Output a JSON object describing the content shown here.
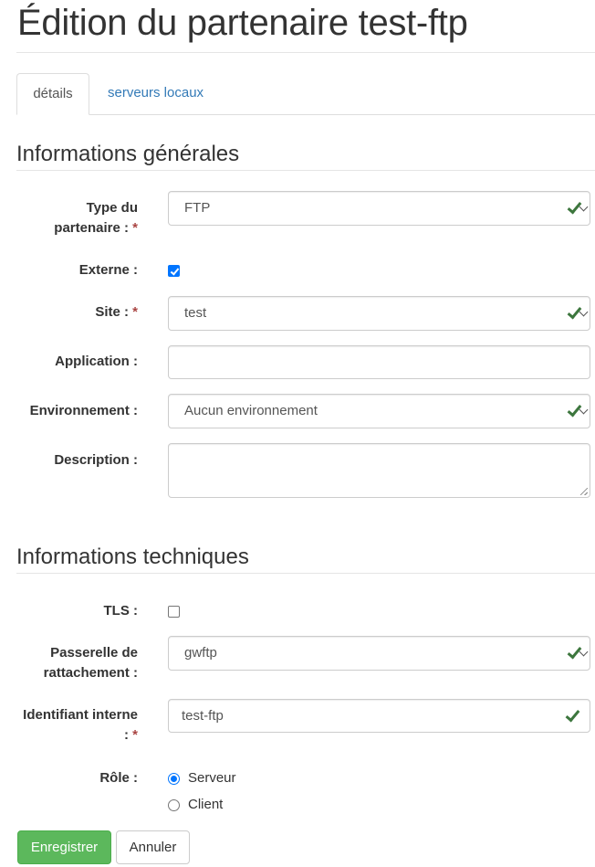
{
  "page": {
    "title": "Édition du partenaire test-ftp"
  },
  "tabs": [
    {
      "label": "détails",
      "active": true
    },
    {
      "label": "serveurs locaux",
      "active": false
    }
  ],
  "general": {
    "heading": "Informations générales",
    "type": {
      "label_line1": "Type du",
      "label_line2": "partenaire : ",
      "required": "*",
      "value": "FTP"
    },
    "externe": {
      "label": "Externe :",
      "checked": true
    },
    "site": {
      "label": "Site : ",
      "required": "*",
      "value": "test"
    },
    "application": {
      "label": "Application :",
      "value": ""
    },
    "environnement": {
      "label": "Environnement :",
      "value": "Aucun environnement"
    },
    "description": {
      "label": "Description :",
      "value": ""
    }
  },
  "technical": {
    "heading": "Informations techniques",
    "tls": {
      "label": "TLS :",
      "checked": false
    },
    "passerelle": {
      "label_line1": "Passerelle de",
      "label_line2": "rattachement :",
      "value": "gwftp"
    },
    "identifiant": {
      "label_line1": "Identifiant interne",
      "label_line2": ": ",
      "required": "*",
      "value": "test-ftp"
    },
    "role": {
      "label": "Rôle :",
      "options": [
        {
          "label": "Serveur",
          "selected": true
        },
        {
          "label": "Client",
          "selected": false
        }
      ]
    }
  },
  "actions": {
    "save_label": "Enregistrer",
    "cancel_label": "Annuler"
  },
  "colors": {
    "primary_button": "#5cb85c",
    "valid_check": "#3c763d",
    "link": "#337ab7",
    "required": "#a94442",
    "checkbox_accent": "#0075ff"
  },
  "icons": {
    "valid": "check-icon",
    "dropdown": "chevron-down-icon"
  }
}
